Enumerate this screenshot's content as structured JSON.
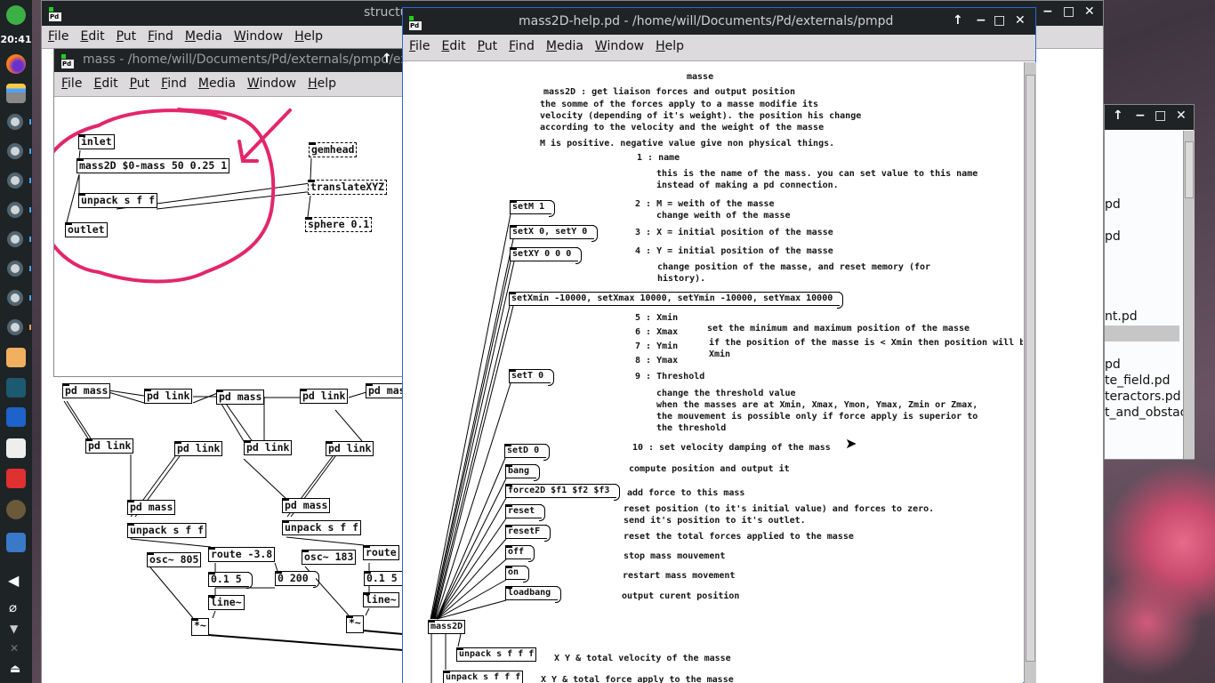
{
  "taskbar": {
    "clock": "20:41",
    "icons": [
      "power-icon",
      "firefox-icon",
      "files-icon",
      "gear-icon",
      "gear-icon",
      "gear-icon",
      "gear-icon",
      "gear-icon",
      "gear-icon",
      "gear-icon",
      "gear-icon",
      "install-icon",
      "book-icon",
      "video-player-icon",
      "image-viewer-icon",
      "screen-recorder-icon",
      "gimp-icon",
      "calculator-icon",
      "volume-icon",
      "clipboard-icon",
      "network-icon",
      "bluetooth-off-icon",
      "eject-icon"
    ]
  },
  "menu": [
    "File",
    "Edit",
    "Put",
    "Find",
    "Media",
    "Window",
    "Help"
  ],
  "structures_window": {
    "title": "structu",
    "objects": {
      "pd_mass": "pd mass",
      "pd_mas": "pd mas",
      "pd_link": "pd link",
      "unpack": "unpack s f f",
      "osc1": "osc~ 805",
      "osc2": "osc~ 183",
      "route1": "route -3.8",
      "route2": "route",
      "msg1": "0.1 5",
      "msg2": "0 200",
      "msg3": "0.1 5",
      "line": "line~",
      "mul": "*~"
    }
  },
  "mass_window": {
    "title": "mass  - /home/will/Documents/Pd/externals/pmpd/ex",
    "objects": {
      "inlet": "inlet",
      "mass2d": "mass2D $0-mass 50 0.25 1",
      "unpack": "unpack s f f",
      "outlet": "outlet",
      "gemhead": "gemhead",
      "translate": "translateXYZ",
      "sphere": "sphere 0.1"
    },
    "annotation_color": "#e3266a"
  },
  "help_window": {
    "title": "mass2D-help.pd  - /home/will/Documents/Pd/externals/pmpd",
    "comments": [
      "masse",
      "mass2D : get liaison forces and output position",
      "the somme of the forces apply to a masse modifie its",
      "velocity (depending of it's weight). the position his change",
      "according to the velocity and the weight of the masse",
      "M is positive. negative value give non physical things.",
      "1 : name",
      "this is the name of the mass. you can set value to this name",
      "instead of making a pd connection.",
      "2 : M = weith of the masse",
      "change weith of the masse",
      "3 : X = initial position of the masse",
      "4 : Y = initial position of the masse",
      "change position of the masse, and reset memory (for",
      "history).",
      "5 : Xmin",
      "6 : Xmax",
      "7 : Ymin",
      "8 : Ymax",
      "set the minimum and maximum position of the masse",
      "if the position of the masse is < Xmin then position will be",
      "Xmin",
      "9 : Threshold",
      "change the threshold value",
      "when the masses are at Xmin, Xmax, Ymon, Ymax, Zmin or Zmax,",
      "the mouvement is possible only if force apply is superior to",
      "the threshold",
      "10 : set velocity damping of the mass",
      "compute position and output it",
      "add force to this mass",
      "reset position (to it's initial value) and forces to zero.",
      "send it's position to it's outlet.",
      "reset the total forces applied to the masse",
      "stop mass mouvement",
      "restart mass movement",
      "output curent position",
      "X Y & total velocity of the masse",
      "X Y & total force apply to the masse"
    ],
    "messages": [
      "setM 1",
      "setX 0, setY 0",
      "setXY 0 0 0",
      "setXmin -10000, setXmax 10000, setYmin -10000, setYmax 10000",
      "setT 0",
      "setD 0",
      "bang",
      "force2D $f1 $f2 $f3",
      "reset",
      "resetF",
      "off",
      "on",
      "loadbang"
    ],
    "objects": [
      "mass2D",
      "unpack s f f f",
      "unpack s f f f"
    ]
  },
  "file_window": {
    "items": [
      "pd",
      "pd",
      "nt.pd",
      "pd",
      "te_field.pd",
      "teractors.pd",
      "t_and_obstac"
    ]
  }
}
